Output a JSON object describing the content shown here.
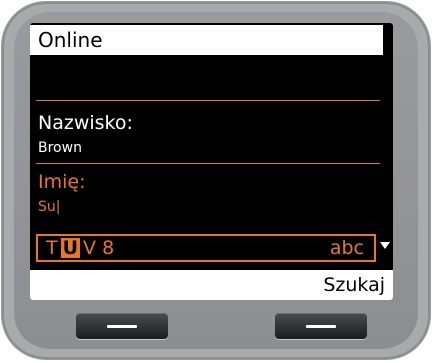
{
  "screen": {
    "title": "Online",
    "fields": [
      {
        "label": "Nazwisko:",
        "value": "Brown"
      },
      {
        "label": "Imię:",
        "value": "Su|"
      }
    ],
    "editor": {
      "chars_before": "T",
      "char_selected": "U",
      "chars_after": "V 8",
      "mode": "abc"
    },
    "softkeys": {
      "right": "Szukaj"
    }
  },
  "colors": {
    "accent": "#e8752a",
    "screen_bg": "#000000",
    "bar_bg": "#ffffff",
    "device_body": "#a9aaac"
  },
  "icons": {
    "scroll_indicator": "down-triangle-icon",
    "left_hardware_key": "dash-icon",
    "right_hardware_key": "dash-icon"
  }
}
